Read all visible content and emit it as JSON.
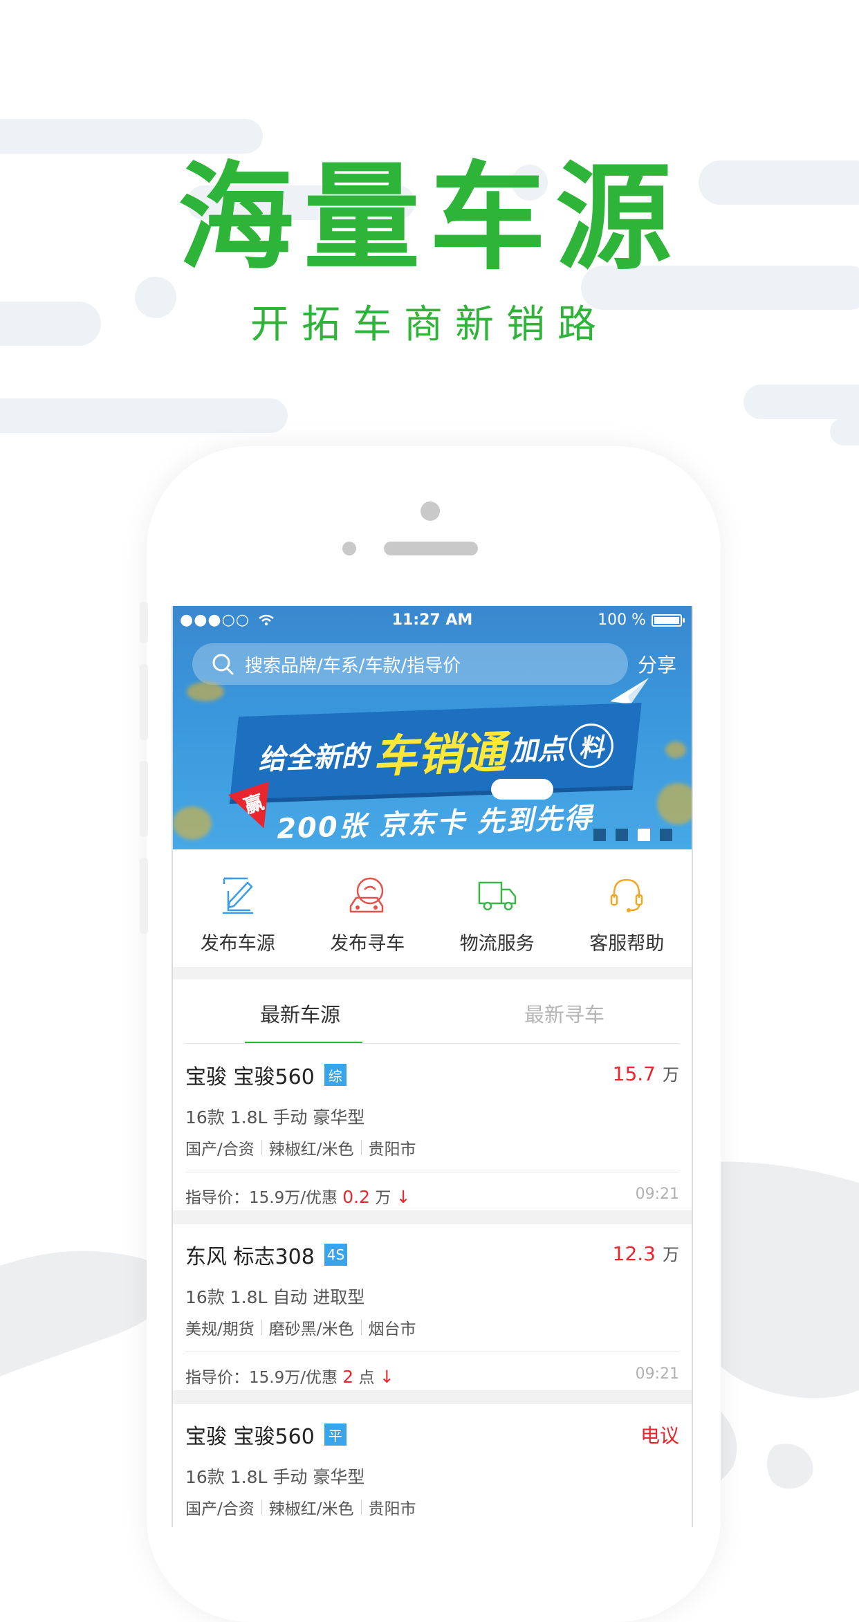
{
  "hero": {
    "headline": "海量车源",
    "subheadline": "开拓车商新销路"
  },
  "status_bar": {
    "signal": "●●●○○",
    "time": "11:27 AM",
    "battery": "100 %"
  },
  "search": {
    "placeholder": "搜索品牌/车系/车款/指导价"
  },
  "share_label": "分享",
  "banner": {
    "title_pre": "给全新的",
    "title_highlight": "车销通",
    "title_post": "加点",
    "title_badge": "料",
    "subtitle": "200张 京东卡 先到先得",
    "badge": "赢",
    "page_count": 4,
    "active_page": 3
  },
  "quick_actions": [
    {
      "label": "发布车源",
      "icon": "edit-icon",
      "color": "#3a9be6"
    },
    {
      "label": "发布寻车",
      "icon": "search-car-icon",
      "color": "#e8504a"
    },
    {
      "label": "物流服务",
      "icon": "truck-icon",
      "color": "#39b54a"
    },
    {
      "label": "客服帮助",
      "icon": "headset-icon",
      "color": "#f5a623"
    }
  ],
  "tabs": [
    {
      "label": "最新车源",
      "active": true
    },
    {
      "label": "最新寻车",
      "active": false
    }
  ],
  "listings": [
    {
      "title": "宝骏 宝骏560",
      "tag": "综",
      "price": "15.7",
      "unit": "万",
      "spec": "16款 1.8L 手动 豪华型",
      "attrs": [
        "国产/合资",
        "辣椒红/米色",
        "贵阳市"
      ],
      "guide_prefix": "指导价：15.9万/优惠",
      "discount": "0.2",
      "discount_unit": "万",
      "arrow": "↓",
      "time": "09:21"
    },
    {
      "title": "东风 标志308",
      "tag": "4S",
      "price": "12.3",
      "unit": "万",
      "spec": "16款 1.8L 自动 进取型",
      "attrs": [
        "美规/期货",
        "磨砂黑/米色",
        "烟台市"
      ],
      "guide_prefix": "指导价：15.9万/优惠",
      "discount": "2",
      "discount_unit": "点",
      "arrow": "↓",
      "time": "09:21"
    },
    {
      "title": "宝骏 宝骏560",
      "tag": "平",
      "price": "电议",
      "unit": "",
      "spec": "16款 1.8L 手动 豪华型",
      "attrs": [
        "国产/合资",
        "辣椒红/米色",
        "贵阳市"
      ]
    }
  ]
}
